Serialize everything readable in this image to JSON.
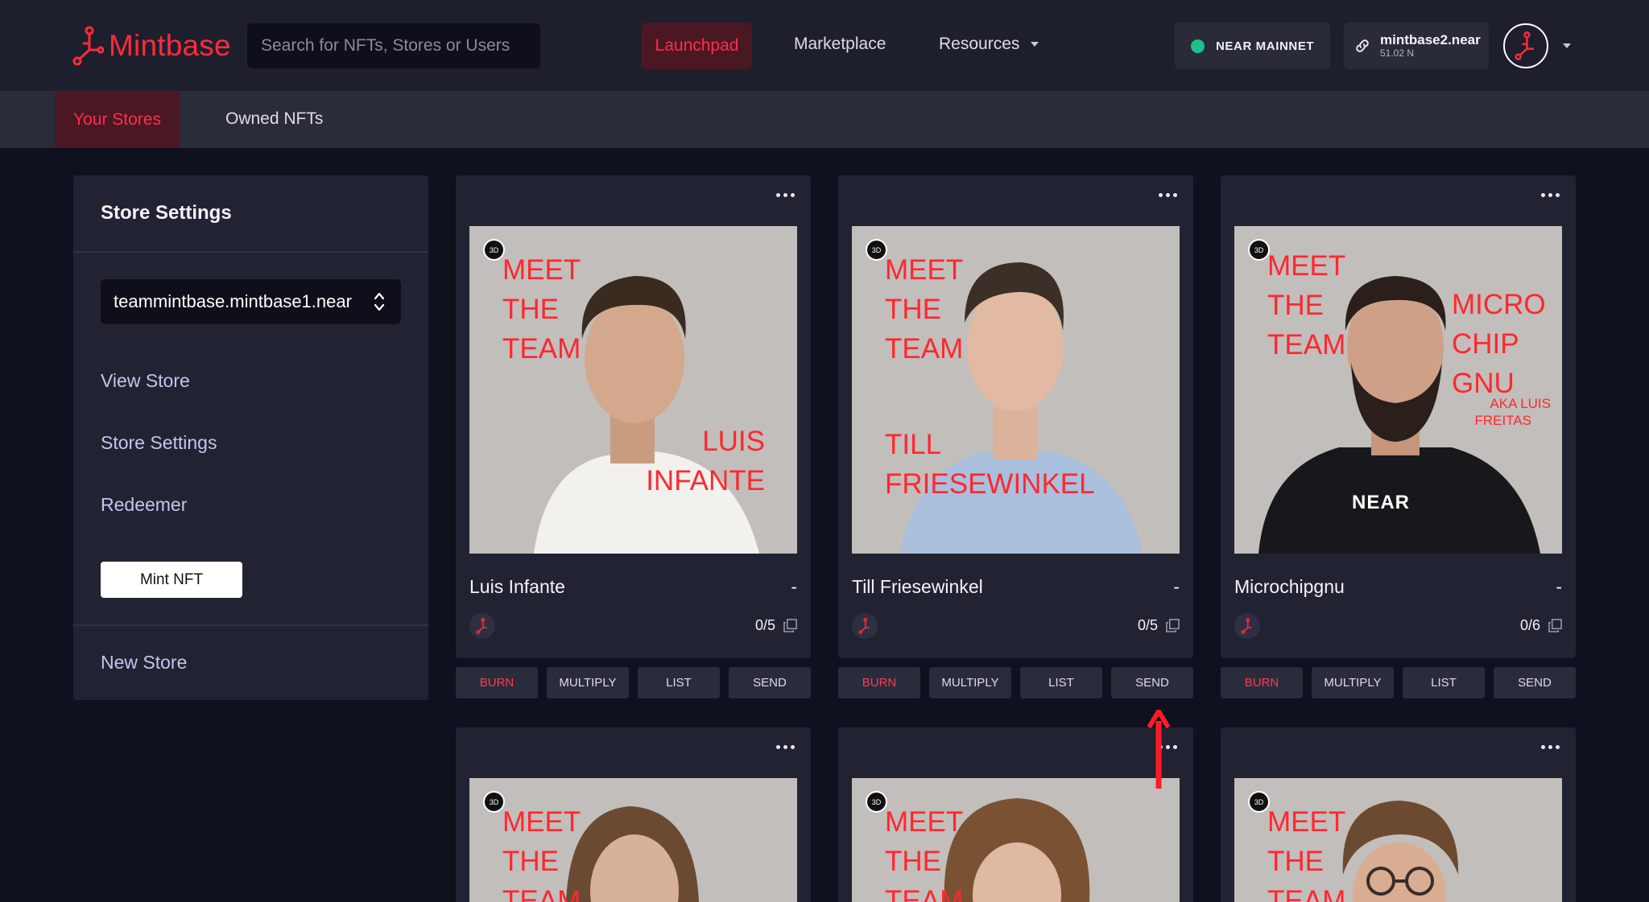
{
  "header": {
    "logo_text": "Mintbase",
    "search_placeholder": "Search for NFTs, Stores or Users",
    "nav": {
      "launchpad": "Launchpad",
      "marketplace": "Marketplace",
      "resources": "Resources"
    },
    "network": "NEAR MAINNET",
    "account": {
      "name": "mintbase2.near",
      "balance": "51.02 N"
    }
  },
  "subnav": {
    "your_stores": "Your Stores",
    "owned_nfts": "Owned NFTs"
  },
  "sidebar": {
    "title": "Store Settings",
    "selected_store": "teammintbase.mintbase1.near",
    "links": {
      "view_store": "View Store",
      "store_settings": "Store Settings",
      "redeemer": "Redeemer"
    },
    "mint_button": "Mint NFT",
    "new_store": "New Store"
  },
  "actions": {
    "burn": "BURN",
    "multiply": "MULTIPLY",
    "list": "LIST",
    "send": "SEND"
  },
  "badge": "3D",
  "cards": [
    {
      "name": "Luis Infante",
      "price": "-",
      "count": "0/5",
      "img": {
        "line1": "MEET",
        "line2": "THE",
        "line3": "TEAM",
        "name1": "LUIS",
        "name2": "INFANTE"
      }
    },
    {
      "name": "Till Friesewinkel",
      "price": "-",
      "count": "0/5",
      "img": {
        "line1": "MEET",
        "line2": "THE",
        "line3": "TEAM",
        "name1": "TILL",
        "name2": "FRIESEWINKEL"
      }
    },
    {
      "name": "Microchipgnu",
      "price": "-",
      "count": "0/6",
      "img": {
        "line1": "MEET",
        "line2": "THE",
        "line3": "TEAM",
        "name1": "MICRO",
        "name2": "CHIP",
        "name3": "GNU",
        "sub1": "AKA LUIS",
        "sub2": "FREITAS",
        "shirt": "NEAR"
      }
    },
    {
      "img": {
        "line1": "MEET",
        "line2": "THE",
        "line3": "TEAM"
      }
    },
    {
      "img": {
        "line1": "MEET",
        "line2": "THE",
        "line3": "TEAM"
      }
    },
    {
      "img": {
        "line1": "MEET",
        "line2": "THE",
        "line3": "TEAM"
      }
    }
  ],
  "colors": {
    "accent": "#ff2d4a",
    "background": "#10111f",
    "panel": "#222332",
    "header": "#1e1f2c",
    "network_dot": "#1fbf8a"
  }
}
